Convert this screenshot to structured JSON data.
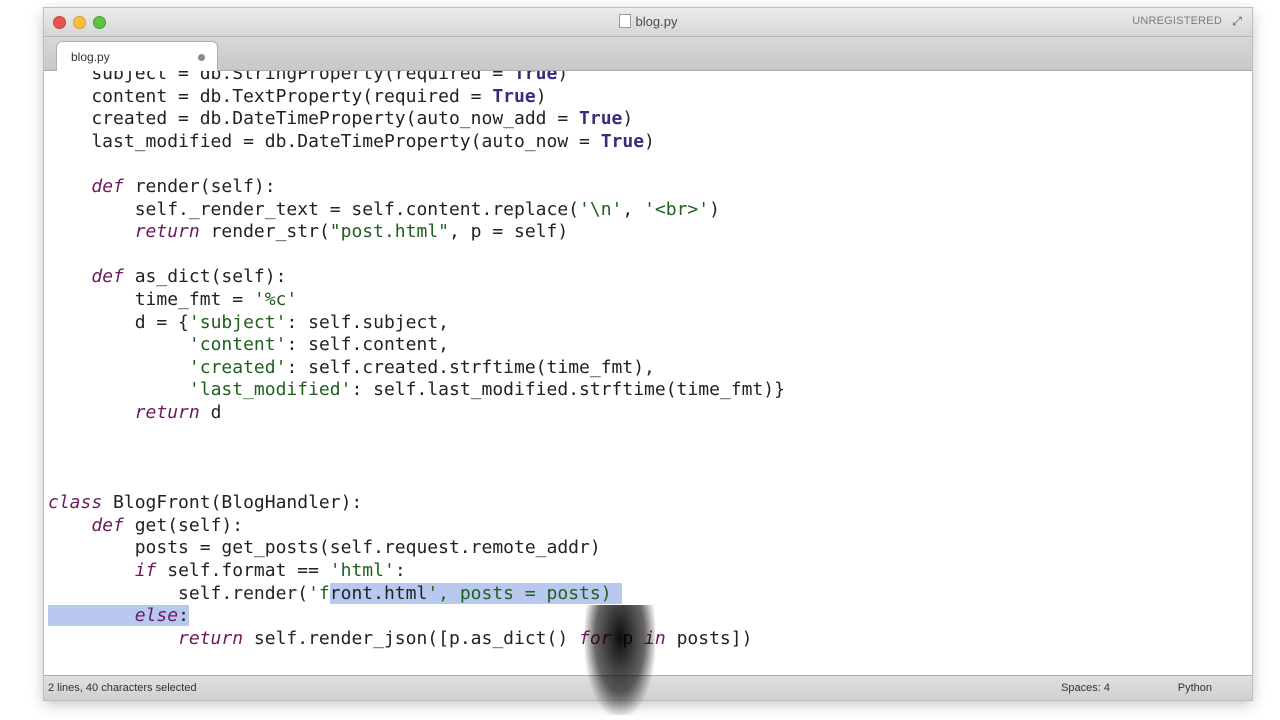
{
  "window": {
    "title": "blog.py",
    "license_label": "UNREGISTERED"
  },
  "tabs": [
    {
      "label": "blog.py",
      "dirty": true
    }
  ],
  "editor": {
    "lines": [
      "    subject = db.StringProperty(required = True)",
      "    content = db.TextProperty(required = True)",
      "    created = db.DateTimeProperty(auto_now_add = True)",
      "    last_modified = db.DateTimeProperty(auto_now = True)",
      "",
      "    def render(self):",
      "        self._render_text = self.content.replace('\\n', '<br>')",
      "        return render_str(\"post.html\", p = self)",
      "",
      "    def as_dict(self):",
      "        time_fmt = '%c'",
      "        d = {'subject': self.subject,",
      "             'content': self.content,",
      "             'created': self.created.strftime(time_fmt),",
      "             'last_modified': self.last_modified.strftime(time_fmt)}",
      "        return d",
      "",
      "",
      "",
      "class BlogFront(BlogHandler):",
      "    def get(self):",
      "        posts = get_posts(self.request.remote_addr)",
      "        if self.format == 'html':",
      "            self.render('front.html', posts = posts)",
      "        else:",
      "            return self.render_json([p.as_dict() for p in posts])"
    ]
  },
  "status": {
    "selection": "2 lines, 40 characters selected",
    "indentation": "Spaces: 4",
    "syntax": "Python"
  },
  "colors": {
    "selection": "#b8c8ee",
    "keyword": "#6d1a5f",
    "string": "#1f5f1f",
    "constant": "#3b2a7a"
  }
}
